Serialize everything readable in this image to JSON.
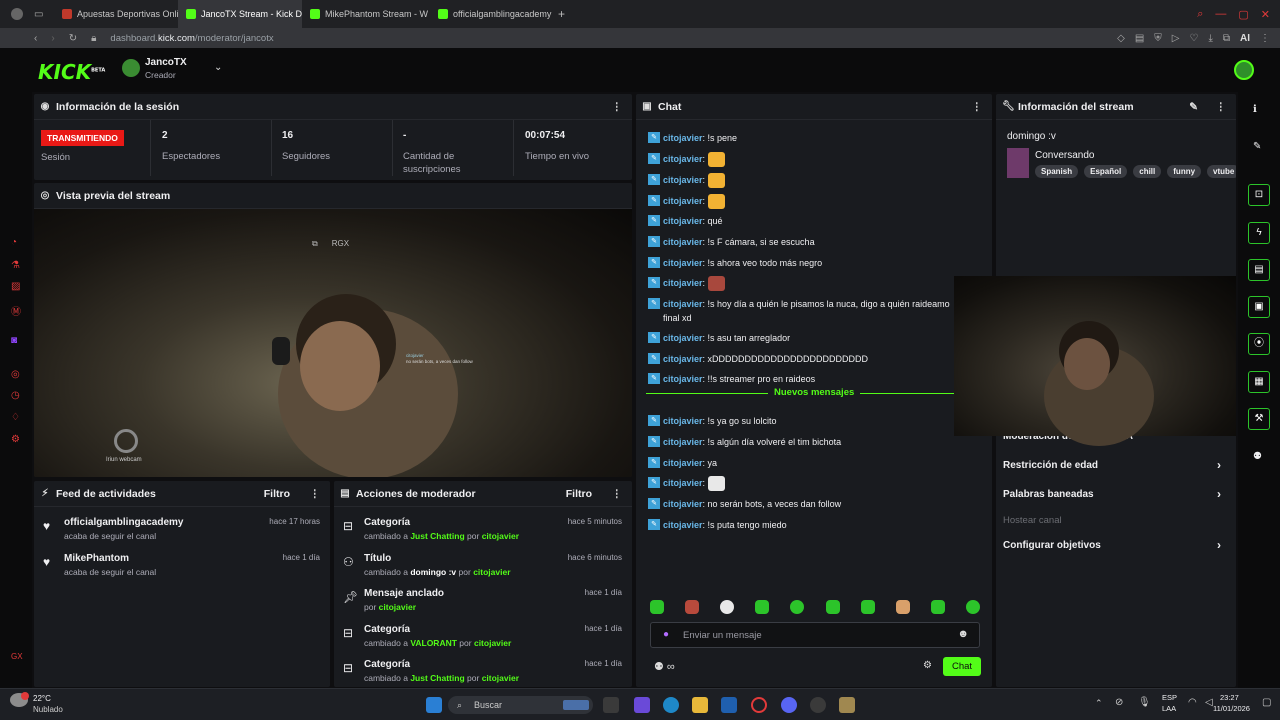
{
  "browser": {
    "tabs": [
      {
        "label": "Apuestas Deportivas Onlin",
        "color": "#c0392b",
        "active": false
      },
      {
        "label": "JancoTX Stream - Kick Da",
        "color": "#53fc18",
        "active": true
      },
      {
        "label": "MikePhantom Stream - W",
        "color": "#53fc18",
        "active": false
      },
      {
        "label": "officialgamblingacademy",
        "color": "#53fc18",
        "active": false
      }
    ],
    "url_domain": "dashboard.kick.com",
    "url_prefix_host": "dashboard.",
    "url_host": "kick.com",
    "url_path": "/moderator/jancotx",
    "ai_label": "AI"
  },
  "header": {
    "logo": "KICK",
    "logo_badge": "BETA",
    "channel_name": "JancoTX",
    "channel_role": "Creador"
  },
  "session": {
    "title": "Información de la sesión",
    "live_badge": "TRANSMITIENDO",
    "live_label": "Sesión",
    "viewers_value": "2",
    "viewers_label": "Espectadores",
    "followers_value": "16",
    "followers_label": "Seguidores",
    "subs_value": "-",
    "subs_label": "Cantidad de suscripciones",
    "uptime_value": "00:07:54",
    "uptime_label": "Tiempo en vivo"
  },
  "preview": {
    "title": "Vista previa del stream",
    "overlay_tag": "RGX",
    "webcam_label": "Iriun webcam",
    "overlay_chat_user": "citojavier",
    "overlay_chat_text": "no serán bots, a veces dan follow"
  },
  "feed": {
    "title": "Feed de actividades",
    "filter_label": "Filtro",
    "items": [
      {
        "name": "officialgamblingacademy",
        "sub": "acaba de seguir el canal",
        "time": "hace 17 horas"
      },
      {
        "name": "MikePhantom",
        "sub": "acaba de seguir el canal",
        "time": "hace 1 día"
      }
    ]
  },
  "modactions": {
    "title": "Acciones de moderador",
    "filter_label": "Filtro",
    "items": [
      {
        "title": "Categoría",
        "pre": "cambiado a",
        "value": "Just Chatting",
        "by": "por",
        "user": "citojavier",
        "time": "hace 5 minutos"
      },
      {
        "title": "Título",
        "pre": "cambiado a",
        "value": "domingo :v",
        "by": "por",
        "user": "citojavier",
        "time": "hace 6 minutos"
      },
      {
        "title": "Mensaje anclado",
        "pre": "",
        "value": "",
        "by": "por",
        "user": "citojavier",
        "time": "hace 1 día"
      },
      {
        "title": "Categoría",
        "pre": "cambiado a",
        "value": "VALORANT",
        "by": "por",
        "user": "citojavier",
        "time": "hace 1 día"
      },
      {
        "title": "Categoría",
        "pre": "cambiado a",
        "value": "Just Chatting",
        "by": "por",
        "user": "citojavier",
        "time": "hace 1 día"
      }
    ]
  },
  "chat": {
    "title": "Chat",
    "messages": [
      {
        "user": "citojavier",
        "text": ": !s pene",
        "emote": ""
      },
      {
        "user": "citojavier",
        "text": ":",
        "emote": "#f2b233"
      },
      {
        "user": "citojavier",
        "text": ":",
        "emote": "#f2b233"
      },
      {
        "user": "citojavier",
        "text": ":",
        "emote": "#f2b233"
      },
      {
        "user": "citojavier",
        "text": ": qué",
        "emote": ""
      },
      {
        "user": "citojavier",
        "text": ": !s F cámara, si se escucha",
        "emote": ""
      },
      {
        "user": "citojavier",
        "text": ": !s ahora veo todo más negro",
        "emote": ""
      },
      {
        "user": "citojavier",
        "text": ":",
        "emote": "#a8483d"
      },
      {
        "user": "citojavier",
        "text": ": !s hoy día a quién le pisamos la nuca, digo a quién raideamo final xd",
        "emote": ""
      },
      {
        "user": "citojavier",
        "text": ": !s asu tan arreglador",
        "emote": ""
      },
      {
        "user": "citojavier",
        "text": ": xDDDDDDDDDDDDDDDDDDDDDDDD",
        "emote": ""
      },
      {
        "user": "citojavier",
        "text": ": !!s streamer pro en raideos",
        "emote": ""
      },
      {
        "user": "citojavier",
        "text": ": !s ya go su lolcito",
        "emote": ""
      },
      {
        "user": "citojavier",
        "text": ": !s algún día volveré el tim bichota",
        "emote": ""
      },
      {
        "user": "citojavier",
        "text": ": ya",
        "emote": ""
      },
      {
        "user": "citojavier",
        "text": ":",
        "emote": "#e8e8e8"
      },
      {
        "user": "citojavier",
        "text": ": no serán bots, a veces dan follow",
        "emote": ""
      },
      {
        "user": "citojavier",
        "text": ": !s puta tengo miedo",
        "emote": ""
      }
    ],
    "new_messages_label": "Nuevos mensajes",
    "input_placeholder": "Enviar un mensaje",
    "send_label": "Chat"
  },
  "stream_info": {
    "title": "Información del stream",
    "stream_title": "domingo :v",
    "category": "Conversando",
    "tags": [
      "Spanish",
      "Español",
      "chill",
      "funny",
      "vtube"
    ],
    "settings": [
      {
        "label": "Moderación del chat con IA",
        "arrow": true
      },
      {
        "label": "Restricción de edad",
        "arrow": true
      },
      {
        "label": "Palabras baneadas",
        "arrow": true
      },
      {
        "label": "Hostear canal",
        "arrow": false
      },
      {
        "label": "Configurar objetivos",
        "arrow": true
      }
    ]
  },
  "taskbar": {
    "weather_temp": "22°C",
    "weather_desc": "Nublado",
    "search_placeholder": "Buscar",
    "lang": "ESP",
    "lang2": "LAA",
    "time": "23:27",
    "date": "11/01/2026"
  },
  "colors": {
    "accent": "#53fc18",
    "live": "#e91916",
    "username": "#69b7e8",
    "panel": "#191b1f"
  }
}
